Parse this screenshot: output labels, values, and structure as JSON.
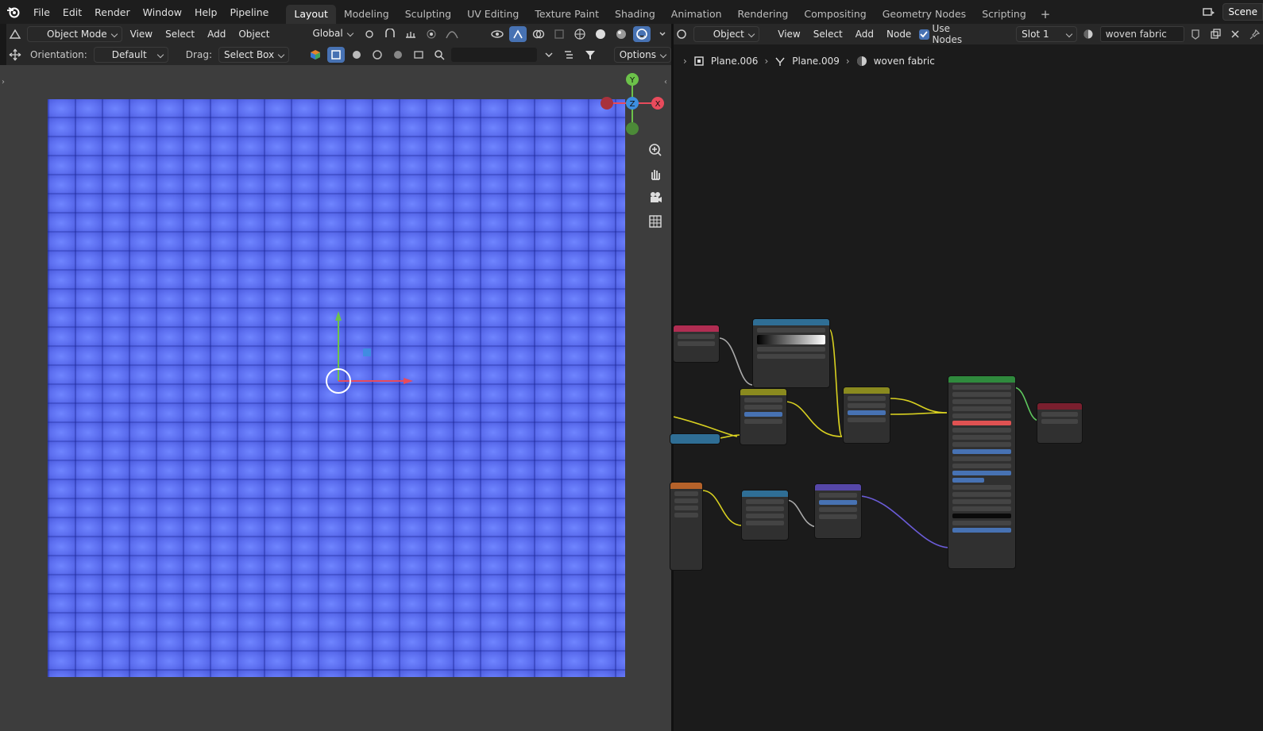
{
  "menu": [
    "File",
    "Edit",
    "Render",
    "Window",
    "Help",
    "Pipeline"
  ],
  "workspaces": [
    "Layout",
    "Modeling",
    "Sculpting",
    "UV Editing",
    "Texture Paint",
    "Shading",
    "Animation",
    "Rendering",
    "Compositing",
    "Geometry Nodes",
    "Scripting"
  ],
  "active_workspace": "Layout",
  "scene_label": "Scene",
  "viewport": {
    "mode": "Object Mode",
    "menus": [
      "View",
      "Select",
      "Add",
      "Object"
    ],
    "transform": "Global",
    "orientation_label": "Orientation:",
    "orientation": "Default",
    "drag_label": "Drag:",
    "drag": "Select Box",
    "options": "Options",
    "axes": {
      "x": "X",
      "y": "Y",
      "z": "Z"
    }
  },
  "node_editor": {
    "type": "Object",
    "menus": [
      "View",
      "Select",
      "Add",
      "Node"
    ],
    "use_nodes_label": "Use Nodes",
    "use_nodes": true,
    "slot": "Slot 1",
    "material": "woven fabric",
    "breadcrumb": [
      "Plane.006",
      "Plane.009",
      "woven fabric"
    ]
  },
  "colors": {
    "accent": "#4772b3",
    "fabric": "#5b6ef2",
    "axis_x": "#e84b5c",
    "axis_y": "#6cc24a",
    "axis_z": "#3d8fe0"
  }
}
